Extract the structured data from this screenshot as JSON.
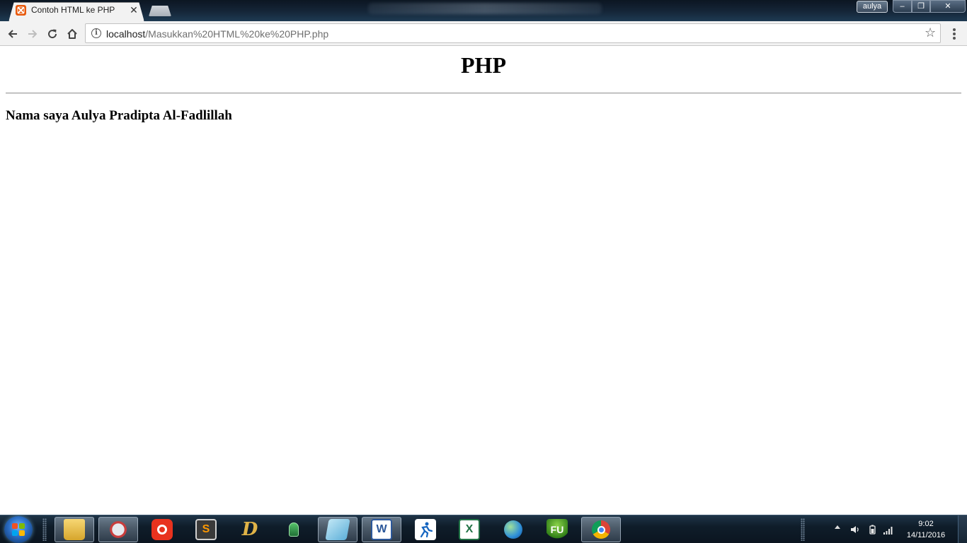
{
  "browser": {
    "tab": {
      "title": "Contoh HTML ke PHP",
      "close_glyph": "✕",
      "favicon": "xampp-icon"
    },
    "profile": "aulya",
    "window_controls": {
      "minimize": "–",
      "maximize": "❐",
      "close": "✕"
    },
    "url": {
      "host": "localhost",
      "path": "/Masukkan%20HTML%20ke%20PHP.php"
    },
    "icons": [
      "back-arrow-icon",
      "forward-arrow-icon",
      "reload-icon",
      "home-icon",
      "info-icon",
      "star-icon",
      "menu-icon"
    ]
  },
  "page": {
    "heading": "PHP",
    "text": "Nama saya Aulya Pradipta Al-Fadlillah"
  },
  "taskbar": {
    "apps": [
      "windows-explorer-icon",
      "snipping-tool-icon",
      "app-red-icon",
      "sublime-text-icon",
      "app-d-icon",
      "app-lock-icon",
      "app-notepad-icon",
      "microsoft-word-icon",
      "app-runner-icon",
      "microsoft-excel-icon",
      "network-globe-icon",
      "app-fu-icon",
      "google-chrome-icon"
    ],
    "clock": {
      "time": "9:02",
      "date": "14/11/2016"
    },
    "tray_icons": [
      "volume-icon",
      "battery-icon",
      "signal-icon"
    ]
  },
  "colors": {
    "taskbar": "#0f1d2a",
    "tab_bg": "#f2f2f2",
    "favicon": "#e8590c"
  }
}
